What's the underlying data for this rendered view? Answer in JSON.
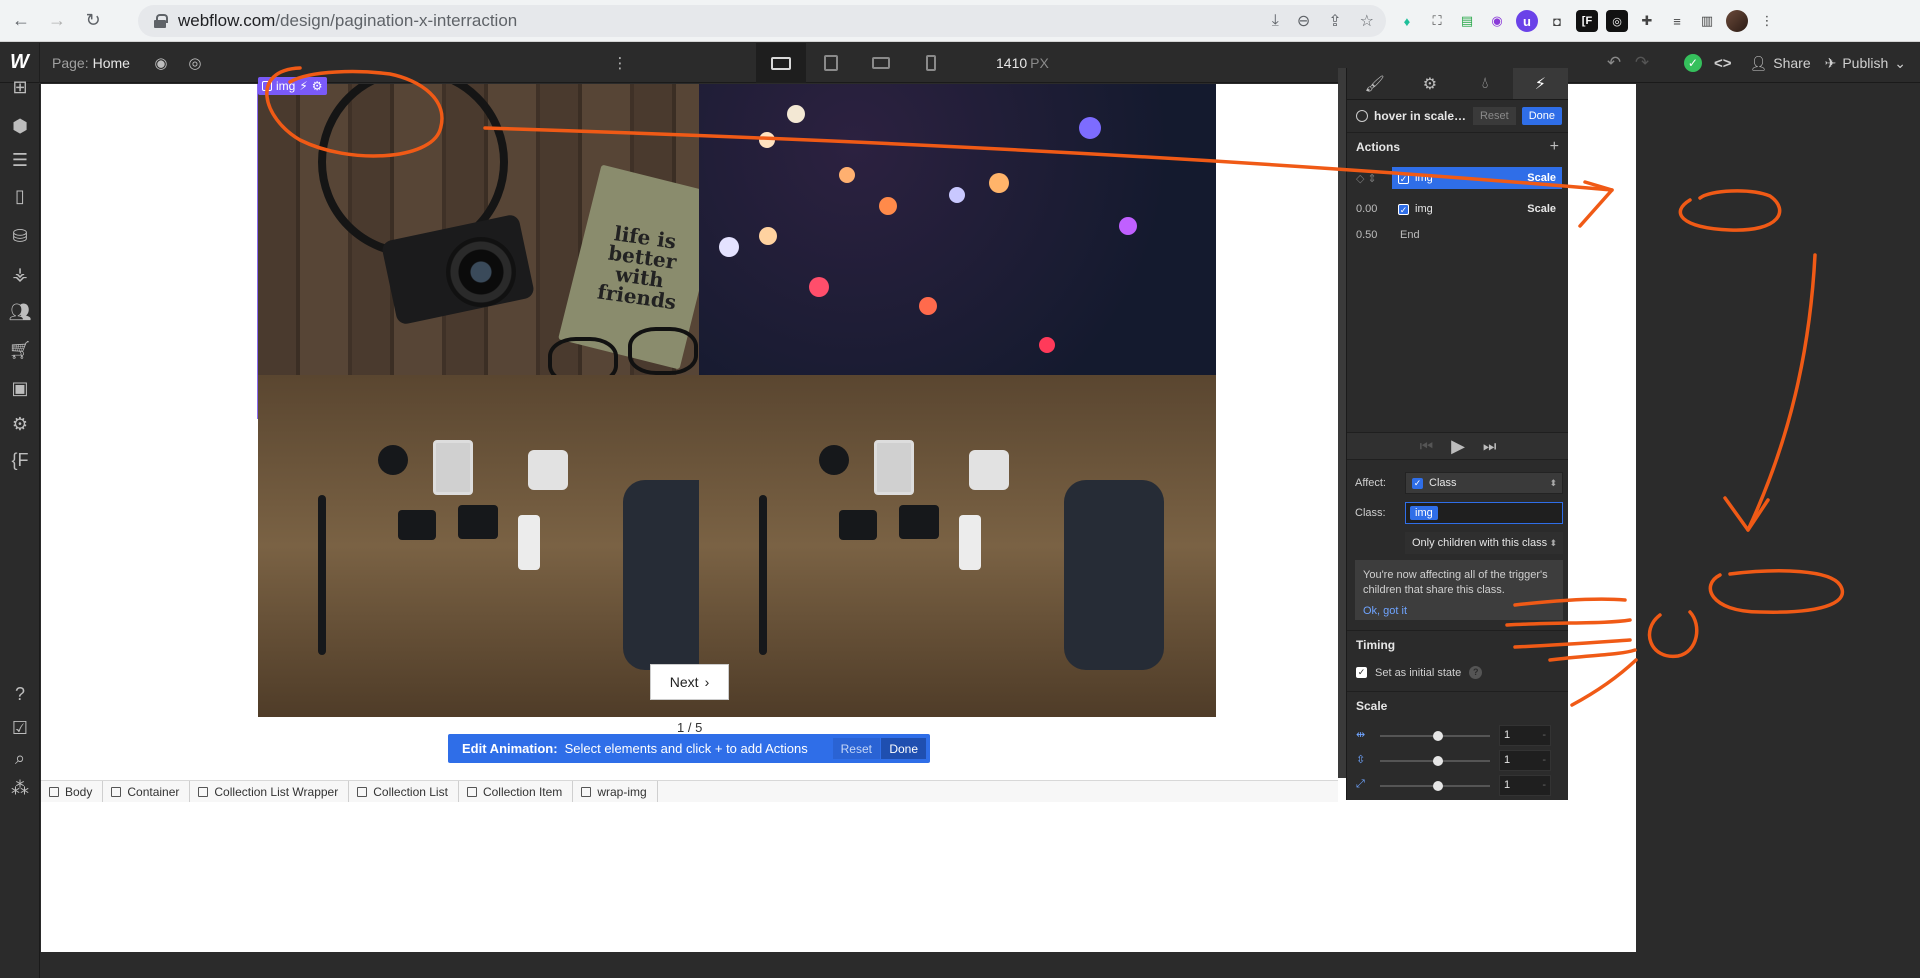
{
  "browser": {
    "url_host": "webflow.com",
    "url_path": "/design/pagination-x-interraction"
  },
  "designer": {
    "page_label": "Page:",
    "page_name": "Home",
    "width_value": "1410",
    "width_unit": "PX",
    "share_label": "Share",
    "publish_label": "Publish"
  },
  "canvas": {
    "selected_tag": "img",
    "notebook_text": "life is better with friends",
    "next_label": "Next",
    "pager_text": "1 / 5",
    "edit_animation": {
      "title": "Edit Animation:",
      "message": "Select elements and click + to add Actions",
      "reset": "Reset",
      "done": "Done"
    }
  },
  "breadcrumb": [
    "Body",
    "Container",
    "Collection List Wrapper",
    "Collection List",
    "Collection Item",
    "wrap-img"
  ],
  "panel": {
    "title": "hover in scale im...",
    "reset": "Reset",
    "done": "Done",
    "actions_label": "Actions",
    "actions": [
      {
        "time": "",
        "name": "img",
        "action": "Scale",
        "selected": true
      },
      {
        "time": "0.00",
        "name": "img",
        "action": "Scale",
        "selected": false
      }
    ],
    "end_time": "0.50",
    "end_label": "End",
    "affect_label": "Affect:",
    "affect_value": "Class",
    "class_label": "Class:",
    "class_value": "img",
    "scope_value": "Only children with this class",
    "info_text": "You're now affecting all of the trigger's children that share this class.",
    "info_ok": "Ok, got it",
    "timing_label": "Timing",
    "initial_state_label": "Set as initial state",
    "scale_label": "Scale",
    "scale_values": [
      "1",
      "1",
      "1"
    ]
  },
  "colors": {
    "accent": "#2f6ee8",
    "selection": "#7a5af8",
    "annotation": "#f05a16"
  }
}
